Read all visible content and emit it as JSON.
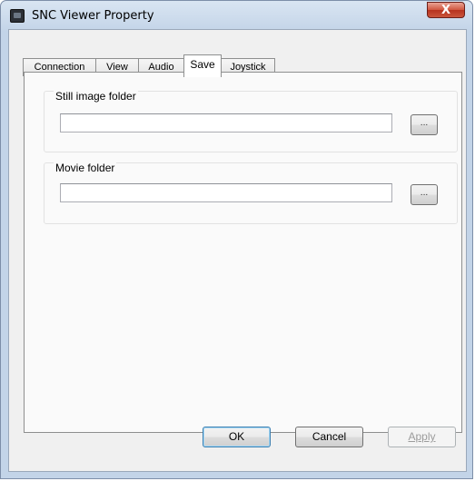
{
  "window": {
    "title": "SNC Viewer Property",
    "close_glyph": "X",
    "icon": "app-camera-icon"
  },
  "tabs": [
    {
      "label": "Connection",
      "selected": false
    },
    {
      "label": "View",
      "selected": false
    },
    {
      "label": "Audio",
      "selected": false
    },
    {
      "label": "Save",
      "selected": true
    },
    {
      "label": "Joystick",
      "selected": false
    }
  ],
  "save_tab": {
    "still_image": {
      "label": "Still image folder",
      "value": "",
      "browse_label": "..."
    },
    "movie": {
      "label": "Movie folder",
      "value": "",
      "browse_label": "..."
    }
  },
  "buttons": {
    "ok": "OK",
    "cancel": "Cancel",
    "apply": "Apply",
    "apply_enabled": false
  },
  "colors": {
    "close_button": "#c9452f",
    "default_button_border": "#3c7fb1",
    "disabled_text": "#9c9c9c"
  }
}
